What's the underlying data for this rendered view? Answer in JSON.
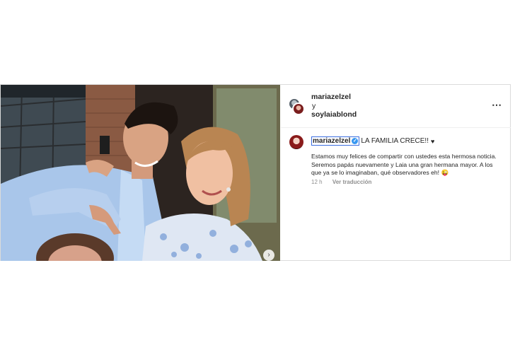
{
  "post": {
    "header": {
      "user1": "mariazelzel",
      "conjunction": "y",
      "user2": "soylaiablond",
      "more_icon": "⋯"
    },
    "caption": {
      "username": "mariazelzel",
      "verified_icon": "✓",
      "headline": "LA FAMILIA CRECE!!",
      "heart": "♥",
      "body": "Estamos muy felices de compartir con ustedes esta hermosa noticia. Seremos papás nuevamente y Laia una gran hermana mayor. A los que ya se lo imaginaban, qué observadores eh! 😜",
      "time": "12 h",
      "translate": "Ver traducción"
    },
    "photo": {
      "next_icon": "›"
    },
    "colors": {
      "verified": "#3897f0",
      "border": "#dbdbdb",
      "muted": "#8e8e8e"
    }
  }
}
